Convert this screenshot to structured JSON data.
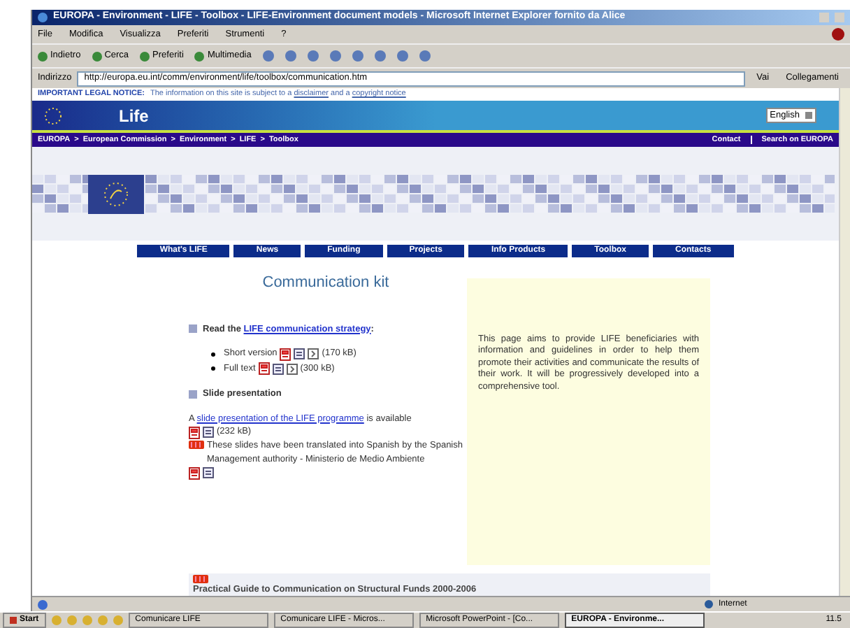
{
  "window": {
    "title": "EUROPA - Environment - LIFE - Toolbox - LIFE-Environment document models - Microsoft Internet Explorer fornito da Alice"
  },
  "menu": [
    "File",
    "Modifica",
    "Visualizza",
    "Preferiti",
    "Strumenti",
    "?"
  ],
  "toolbar": [
    {
      "label": "Indietro"
    },
    {
      "label": "Cerca"
    },
    {
      "label": "Preferiti"
    },
    {
      "label": "Multimedia"
    }
  ],
  "address": {
    "label": "Indirizzo",
    "value": "http://europa.eu.int/comm/environment/life/toolbox/communication.htm",
    "go": "Vai",
    "links": "Collegamenti"
  },
  "legal_notice": {
    "prefix": "IMPORTANT LEGAL NOTICE:",
    "text": "The information on this site is subject to a",
    "link1": "disclaimer",
    "middle": "and a",
    "link2": "copyright notice"
  },
  "site": {
    "title": "Life",
    "language": "English"
  },
  "breadcrumb": [
    "EUROPA",
    "European Commission",
    "Environment",
    "LIFE",
    "Toolbox"
  ],
  "breadcrumb_separator": ">",
  "top_links": [
    "Contact",
    "Search on EUROPA"
  ],
  "nav": [
    "What's LIFE",
    "News",
    "Funding",
    "Projects",
    "Info Products",
    "Toolbox",
    "Contacts"
  ],
  "content": {
    "heading": "Communication kit",
    "strategy": {
      "prefix": "Read the",
      "link": "LIFE communication strategy",
      "suffix": ":",
      "items": [
        {
          "label": "Short version",
          "size": "(170 kB)"
        },
        {
          "label": "Full text",
          "size": "(300 kB)"
        }
      ]
    },
    "slides": {
      "heading": "Slide presentation",
      "prefix": "A",
      "link": "slide presentation of the LIFE programme",
      "suffix": "is available",
      "size": "(232 kB)",
      "note": "These slides have been translated into Spanish by the Spanish Management authority - Ministerio de Medio Ambiente"
    },
    "info": "This page aims to provide LIFE beneficiaries with information and guidelines in order to help them promote their activities and communicate the results of their work. It will be progressively developed into a comprehensive tool.",
    "guide": "Practical Guide to Communication on Structural Funds 2000-2006"
  },
  "status_bar": {
    "zone": "Internet"
  },
  "taskbar": {
    "start": "Start",
    "tasks": [
      {
        "label": "Comunicare LIFE",
        "selected": false
      },
      {
        "label": "Comunicare LIFE - Micros...",
        "selected": false
      },
      {
        "label": "Microsoft PowerPoint - [Co...",
        "selected": false
      },
      {
        "label": "EUROPA - Environme...",
        "selected": true
      }
    ],
    "clock": "11.5"
  }
}
